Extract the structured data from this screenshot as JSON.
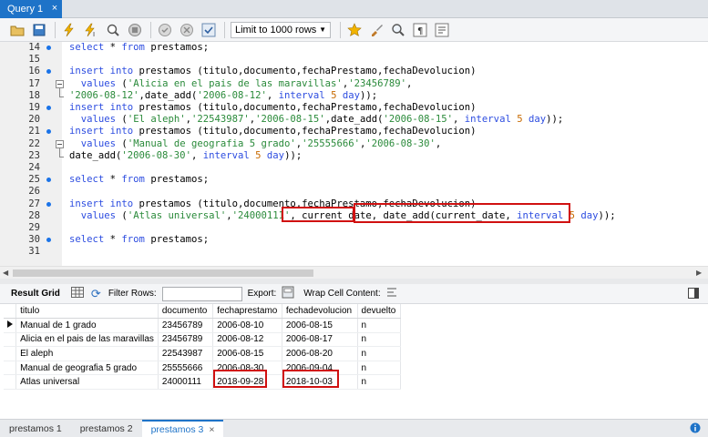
{
  "query_tab": {
    "label": "Query 1",
    "close": "×"
  },
  "toolbar": {
    "limit_label": "Limit to 1000 rows"
  },
  "editor": {
    "lines": [
      {
        "n": "14",
        "parts": [
          [
            "kw",
            "select"
          ],
          [
            "txt",
            " * "
          ],
          [
            "kw",
            "from"
          ],
          [
            "txt",
            " prestamos;"
          ]
        ]
      },
      {
        "n": "15",
        "parts": []
      },
      {
        "n": "16",
        "parts": [
          [
            "kw",
            "insert into"
          ],
          [
            "txt",
            " prestamos (titulo,documento,fechaPrestamo,fechaDevolucion)"
          ]
        ]
      },
      {
        "n": "17",
        "parts": [
          [
            "txt",
            "  "
          ],
          [
            "kw",
            "values"
          ],
          [
            "txt",
            " ("
          ],
          [
            "str",
            "'Alicia en el pais de las maravillas'"
          ],
          [
            "txt",
            ","
          ],
          [
            "str",
            "'23456789'"
          ],
          [
            "txt",
            ","
          ]
        ]
      },
      {
        "n": "18",
        "parts": [
          [
            "str",
            "'2006-08-12'"
          ],
          [
            "txt",
            ",date_add("
          ],
          [
            "str",
            "'2006-08-12'"
          ],
          [
            "txt",
            ", "
          ],
          [
            "kw",
            "interval"
          ],
          [
            "txt",
            " "
          ],
          [
            "num",
            "5"
          ],
          [
            "txt",
            " "
          ],
          [
            "kw",
            "day"
          ],
          [
            "txt",
            "));"
          ]
        ]
      },
      {
        "n": "19",
        "parts": [
          [
            "kw",
            "insert into"
          ],
          [
            "txt",
            " prestamos (titulo,documento,fechaPrestamo,fechaDevolucion)"
          ]
        ]
      },
      {
        "n": "20",
        "parts": [
          [
            "txt",
            "  "
          ],
          [
            "kw",
            "values"
          ],
          [
            "txt",
            " ("
          ],
          [
            "str",
            "'El aleph'"
          ],
          [
            "txt",
            ","
          ],
          [
            "str",
            "'22543987'"
          ],
          [
            "txt",
            ","
          ],
          [
            "str",
            "'2006-08-15'"
          ],
          [
            "txt",
            ",date_add("
          ],
          [
            "str",
            "'2006-08-15'"
          ],
          [
            "txt",
            ", "
          ],
          [
            "kw",
            "interval"
          ],
          [
            "txt",
            " "
          ],
          [
            "num",
            "5"
          ],
          [
            "txt",
            " "
          ],
          [
            "kw",
            "day"
          ],
          [
            "txt",
            "));"
          ]
        ]
      },
      {
        "n": "21",
        "parts": [
          [
            "kw",
            "insert into"
          ],
          [
            "txt",
            " prestamos (titulo,documento,fechaPrestamo,fechaDevolucion)"
          ]
        ]
      },
      {
        "n": "22",
        "parts": [
          [
            "txt",
            "  "
          ],
          [
            "kw",
            "values"
          ],
          [
            "txt",
            " ("
          ],
          [
            "str",
            "'Manual de geografia 5 grado'"
          ],
          [
            "txt",
            ","
          ],
          [
            "str",
            "'25555666'"
          ],
          [
            "txt",
            ","
          ],
          [
            "str",
            "'2006-08-30'"
          ],
          [
            "txt",
            ","
          ]
        ]
      },
      {
        "n": "23",
        "parts": [
          [
            "txt",
            "date_add("
          ],
          [
            "str",
            "'2006-08-30'"
          ],
          [
            "txt",
            ", "
          ],
          [
            "kw",
            "interval"
          ],
          [
            "txt",
            " "
          ],
          [
            "num",
            "5"
          ],
          [
            "txt",
            " "
          ],
          [
            "kw",
            "day"
          ],
          [
            "txt",
            "));"
          ]
        ]
      },
      {
        "n": "24",
        "parts": []
      },
      {
        "n": "25",
        "parts": [
          [
            "kw",
            "select"
          ],
          [
            "txt",
            " * "
          ],
          [
            "kw",
            "from"
          ],
          [
            "txt",
            " prestamos;"
          ]
        ]
      },
      {
        "n": "26",
        "parts": []
      },
      {
        "n": "27",
        "parts": [
          [
            "kw",
            "insert into"
          ],
          [
            "txt",
            " prestamos (titulo,documento,fechaPrestamo,fechaDevolucion)"
          ]
        ]
      },
      {
        "n": "28",
        "parts": [
          [
            "txt",
            "  "
          ],
          [
            "kw",
            "values"
          ],
          [
            "txt",
            " ("
          ],
          [
            "str",
            "'Atlas universal'"
          ],
          [
            "txt",
            ","
          ],
          [
            "str",
            "'24000111'"
          ],
          [
            "txt",
            ", current_date, date_add(current_date, "
          ],
          [
            "kw",
            "interval"
          ],
          [
            "txt",
            " "
          ],
          [
            "num",
            "5"
          ],
          [
            "txt",
            " "
          ],
          [
            "kw",
            "day"
          ],
          [
            "txt",
            "));"
          ]
        ]
      },
      {
        "n": "29",
        "parts": []
      },
      {
        "n": "30",
        "parts": [
          [
            "kw",
            "select"
          ],
          [
            "txt",
            " * "
          ],
          [
            "kw",
            "from"
          ],
          [
            "txt",
            " prestamos;"
          ]
        ]
      },
      {
        "n": "31",
        "parts": []
      }
    ]
  },
  "result_toolbar": {
    "result_grid": "Result Grid",
    "filter_rows": "Filter Rows:",
    "export": "Export:",
    "wrap": "Wrap Cell Content:"
  },
  "grid": {
    "columns": [
      "titulo",
      "documento",
      "fechaprestamo",
      "fechadevolucion",
      "devuelto"
    ],
    "rows": [
      [
        "Manual de 1 grado",
        "23456789",
        "2006-08-10",
        "2006-08-15",
        "n"
      ],
      [
        "Alicia en el pais de las maravillas",
        "23456789",
        "2006-08-12",
        "2006-08-17",
        "n"
      ],
      [
        "El aleph",
        "22543987",
        "2006-08-15",
        "2006-08-20",
        "n"
      ],
      [
        "Manual de geografia 5 grado",
        "25555666",
        "2006-08-30",
        "2006-09-04",
        "n"
      ],
      [
        "Atlas universal",
        "24000111",
        "2018-09-28",
        "2018-10-03",
        "n"
      ]
    ]
  },
  "bottom_tabs": [
    "prestamos 1",
    "prestamos 2",
    "prestamos 3"
  ],
  "close_mark": "×",
  "colors": {
    "accent": "#1e73c8",
    "highlight": "#d01010",
    "keyword": "#2d4de0",
    "string": "#2a8a3a",
    "number": "#c86a00"
  }
}
